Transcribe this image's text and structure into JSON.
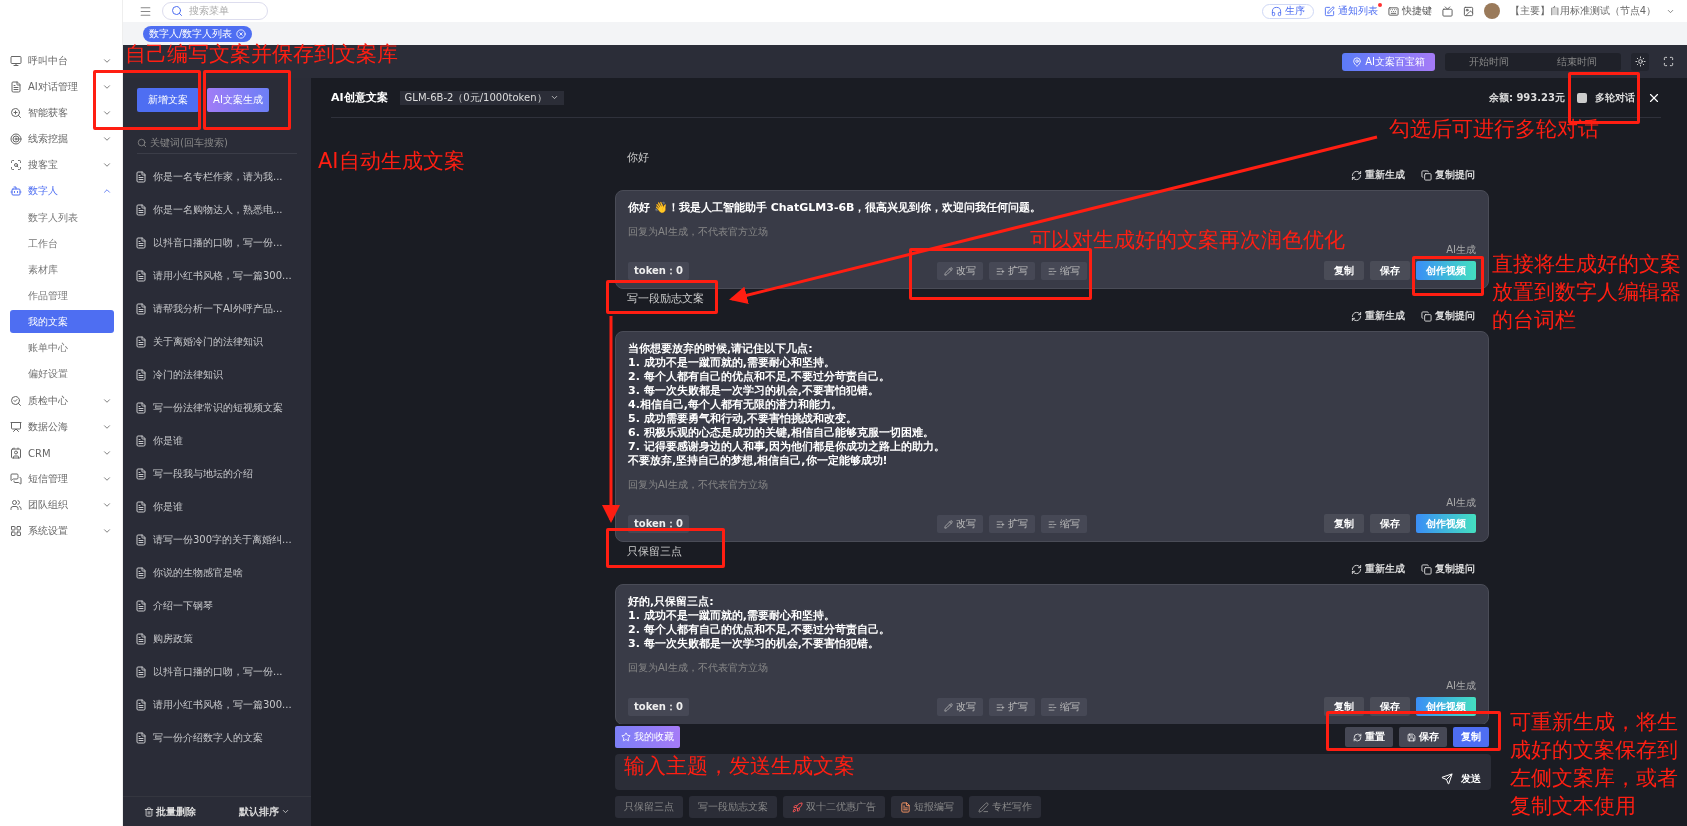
{
  "top_bar": {
    "search_placeholder": "搜索菜单",
    "items": [
      {
        "kind": "pill",
        "label": "生序"
      },
      {
        "kind": "notice",
        "label": "通知列表",
        "unread": true
      },
      {
        "kind": "link",
        "label": "快捷键"
      }
    ],
    "account": "【主要】自用标准测试（节点4）"
  },
  "breadcrumb_tag": "数字人/数字人列表",
  "sidebar": {
    "items": [
      {
        "label": "呼叫中台",
        "selected": false,
        "expanded": false
      },
      {
        "label": "AI对话管理",
        "selected": false,
        "expanded": false
      },
      {
        "label": "智能获客",
        "selected": false,
        "expanded": false
      },
      {
        "label": "线索挖掘",
        "selected": false,
        "expanded": false
      },
      {
        "label": "搜客宝",
        "selected": false,
        "expanded": false
      },
      {
        "label": "数字人",
        "selected": true,
        "expanded": true,
        "children": [
          {
            "label": "数字人列表",
            "selected": false
          },
          {
            "label": "工作台",
            "selected": false
          },
          {
            "label": "素材库",
            "selected": false
          },
          {
            "label": "作品管理",
            "selected": false
          },
          {
            "label": "我的文案",
            "selected": true
          },
          {
            "label": "账单中心",
            "selected": false
          },
          {
            "label": "偏好设置",
            "selected": false
          }
        ]
      },
      {
        "label": "质检中心",
        "selected": false,
        "expanded": false
      },
      {
        "label": "数据公海",
        "selected": false,
        "expanded": false
      },
      {
        "label": "CRM",
        "selected": false,
        "expanded": false
      },
      {
        "label": "短信管理",
        "selected": false,
        "expanded": false
      },
      {
        "label": "团队组织",
        "selected": false,
        "expanded": false
      },
      {
        "label": "系统设置",
        "selected": false,
        "expanded": false
      }
    ]
  },
  "header": {
    "treasure_button": "AI文案百宝箱",
    "start_placeholder": "开始时间",
    "end_placeholder": "结束时间"
  },
  "library": {
    "new_button": "新增文案",
    "ai_button": "AI文案生成",
    "search_placeholder": "关键词(回车搜索)",
    "items": [
      "你是一名专栏作家，请为我...",
      "你是一名购物达人，熟悉电...",
      "以抖音口播的口吻，写一份...",
      "请用小红书风格，写一篇300...",
      "请帮我分析一下AI外呼产品...",
      "关于离婚冷门的法律知识",
      "冷门的法律知识",
      "写一份法律常识的短视频文案",
      "你是谁",
      "写一段我与地坛的介绍",
      "你是谁",
      "请写一份300字的关于离婚纠...",
      "你说的生物感官是啥",
      "介绍一下钢琴",
      "购房政策",
      "以抖音口播的口吻，写一份...",
      "请用小红书风格，写一篇300...",
      "写一份介绍数字人的文案"
    ],
    "delete_button": "批量删除",
    "sort_button": "默认排序"
  },
  "chat": {
    "title": "AI创意文案",
    "model": "GLM-6B-2（0元/1000token）",
    "balance_label": "余额:",
    "balance": "993.23元",
    "multi_turn": {
      "label": "多轮对话",
      "checked": false
    },
    "messages": [
      {
        "kind": "user",
        "text": "你好",
        "actions": [
          "重新生成",
          "复制提问"
        ]
      },
      {
        "kind": "ai",
        "lines": [
          "你好 👋！我是人工智能助手 ChatGLM3-6B，很高兴见到你，欢迎问我任何问题。"
        ],
        "disclaimer": "回复为AI生成，不代表官方立场",
        "token": "token：0",
        "edit_actions": [
          "改写",
          "扩写",
          "缩写"
        ],
        "source": "AI生成",
        "buttons": [
          "复制",
          "保存",
          "创作视频"
        ]
      },
      {
        "kind": "user",
        "text": "写一段励志文案",
        "actions": [
          "重新生成",
          "复制提问"
        ]
      },
      {
        "kind": "ai",
        "lines": [
          "当你想要放弃的时候,请记住以下几点:",
          "1. 成功不是一蹴而就的,需要耐心和坚持。",
          "2. 每个人都有自己的优点和不足,不要过分苛责自己。",
          "3. 每一次失败都是一次学习的机会,不要害怕犯错。",
          "4.相信自己,每个人都有无限的潜力和能力。",
          "5. 成功需要勇气和行动,不要害怕挑战和改变。",
          "6. 积极乐观的心态是成功的关键,相信自己能够克服一切困难。",
          "7. 记得要感谢身边的人和事,因为他们都是你成功之路上的助力。",
          "不要放弃,坚持自己的梦想,相信自己,你一定能够成功!"
        ],
        "disclaimer": "回复为AI生成，不代表官方立场",
        "token": "token：0",
        "edit_actions": [
          "改写",
          "扩写",
          "缩写"
        ],
        "source": "AI生成",
        "buttons": [
          "复制",
          "保存",
          "创作视频"
        ]
      },
      {
        "kind": "user",
        "text": "只保留三点",
        "actions": [
          "重新生成",
          "复制提问"
        ]
      },
      {
        "kind": "ai",
        "lines": [
          "好的,只保留三点:",
          "1. 成功不是一蹴而就的,需要耐心和坚持。",
          "2. 每个人都有自己的优点和不足,不要过分苛责自己。",
          "3. 每一次失败都是一次学习的机会,不要害怕犯错。"
        ],
        "disclaimer": "回复为AI生成，不代表官方立场",
        "token": "token：0",
        "edit_actions": [
          "改写",
          "扩写",
          "缩写"
        ],
        "source": "AI生成",
        "buttons": [
          "复制",
          "保存",
          "创作视频"
        ]
      }
    ],
    "favorites_button": "我的收藏",
    "toolbar": [
      "重置",
      "保存",
      "复制"
    ],
    "send_button": "发送",
    "suggestions": [
      {
        "kind": "plain",
        "label": "只保留三点"
      },
      {
        "kind": "plain",
        "label": "写一段励志文案"
      },
      {
        "kind": "rocket",
        "label": "双十二优惠广告"
      },
      {
        "kind": "doc",
        "label": "短报编写"
      },
      {
        "kind": "pen",
        "label": "专栏写作"
      }
    ]
  },
  "annotations": [
    "自己编写文案并保存到文案库",
    "AI自动生成文案",
    "勾选后可进行多轮对话",
    "可以对生成好的文案再次润色优化",
    "直接将生成好的文案放置到数字人编辑器的台词栏",
    "输入主题，发送生成文案",
    "可重新生成，将生成好的文案保存到左侧文案库，或者复制文本使用"
  ]
}
